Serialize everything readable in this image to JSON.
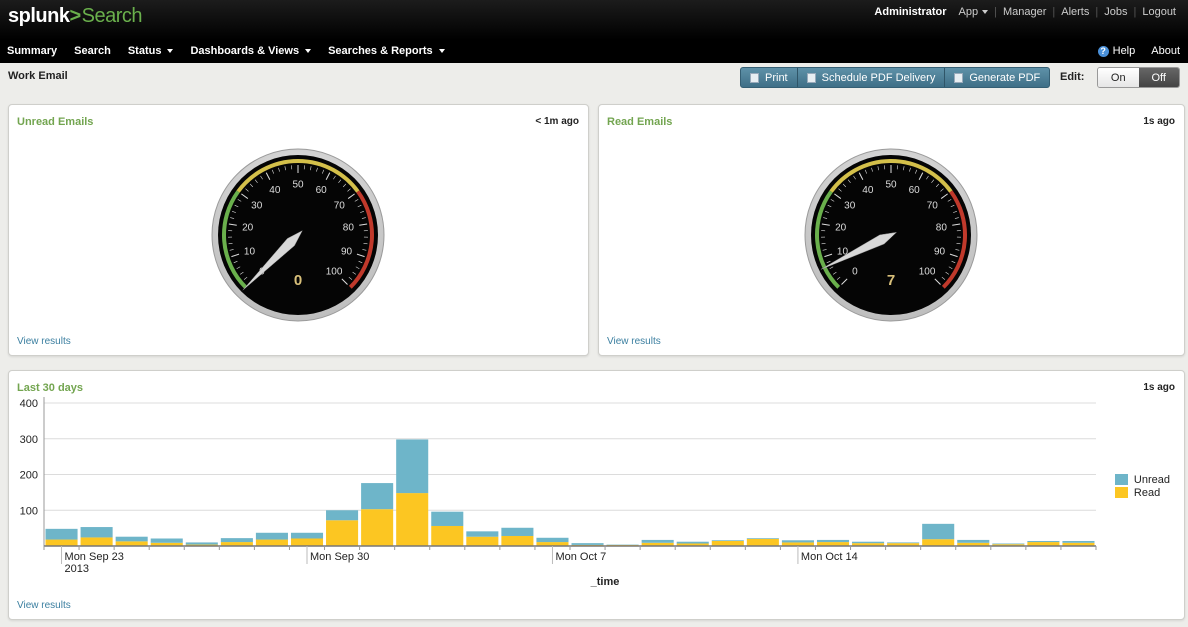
{
  "header": {
    "logo_brand": "splunk",
    "logo_gt": ">",
    "logo_app": "Search",
    "user": "Administrator",
    "app_menu": "App",
    "links": [
      "Manager",
      "Alerts",
      "Jobs",
      "Logout"
    ]
  },
  "nav": {
    "items": [
      {
        "label": "Summary",
        "dropdown": false
      },
      {
        "label": "Search",
        "dropdown": false
      },
      {
        "label": "Status",
        "dropdown": true
      },
      {
        "label": "Dashboards & Views",
        "dropdown": true
      },
      {
        "label": "Searches & Reports",
        "dropdown": true
      }
    ],
    "help": "Help",
    "about": "About"
  },
  "page": {
    "title": "Work Email",
    "buttons": {
      "print": "Print",
      "schedule": "Schedule PDF Delivery",
      "generate": "Generate PDF"
    },
    "edit_label": "Edit:",
    "toggle_on": "On",
    "toggle_off": "Off"
  },
  "panels": {
    "unread": {
      "title": "Unread Emails",
      "time": "< 1m ago",
      "value": 0,
      "view_results": "View results"
    },
    "read": {
      "title": "Read Emails",
      "time": "1s ago",
      "value": 7,
      "view_results": "View results"
    },
    "history": {
      "title": "Last 30 days",
      "time": "1s ago",
      "view_results": "View results"
    }
  },
  "gauge": {
    "min": 0,
    "max": 100,
    "ticks": [
      "0",
      "10",
      "20",
      "30",
      "40",
      "50",
      "60",
      "70",
      "80",
      "90",
      "100"
    ],
    "ranges": [
      {
        "from": 0,
        "to": 30,
        "color": "#6ab04c"
      },
      {
        "from": 30,
        "to": 70,
        "color": "#d4c04a"
      },
      {
        "from": 70,
        "to": 100,
        "color": "#c0392b"
      }
    ]
  },
  "colors": {
    "unread": "#6eb5c9",
    "read": "#fcc622",
    "accent": "#73a550"
  },
  "chart_data": {
    "type": "bar",
    "stacked": true,
    "xlabel": "_time",
    "ylabel": "",
    "ylim": [
      0,
      400
    ],
    "yticks": [
      "100",
      "200",
      "300",
      "400"
    ],
    "x_tick_labels": [
      {
        "index": 0,
        "label": "Mon Sep 23",
        "sub": "2013"
      },
      {
        "index": 7,
        "label": "Mon Sep 30",
        "sub": ""
      },
      {
        "index": 14,
        "label": "Mon Oct 7",
        "sub": ""
      },
      {
        "index": 21,
        "label": "Mon Oct 14",
        "sub": ""
      }
    ],
    "grid": true,
    "legend": "right",
    "series": [
      {
        "name": "Unread",
        "color": "#6eb5c9",
        "values": [
          30,
          29,
          13,
          12,
          6,
          11,
          19,
          16,
          28,
          73,
          150,
          40,
          15,
          23,
          12,
          5,
          1,
          8,
          5,
          2,
          2,
          6,
          6,
          4,
          2,
          43,
          8,
          2,
          3,
          5
        ]
      },
      {
        "name": "Read",
        "color": "#fcc622",
        "values": [
          18,
          24,
          13,
          9,
          4,
          11,
          18,
          21,
          72,
          103,
          148,
          56,
          26,
          28,
          11,
          3,
          3,
          9,
          7,
          14,
          20,
          10,
          11,
          8,
          8,
          19,
          9,
          5,
          11,
          9
        ]
      }
    ]
  }
}
